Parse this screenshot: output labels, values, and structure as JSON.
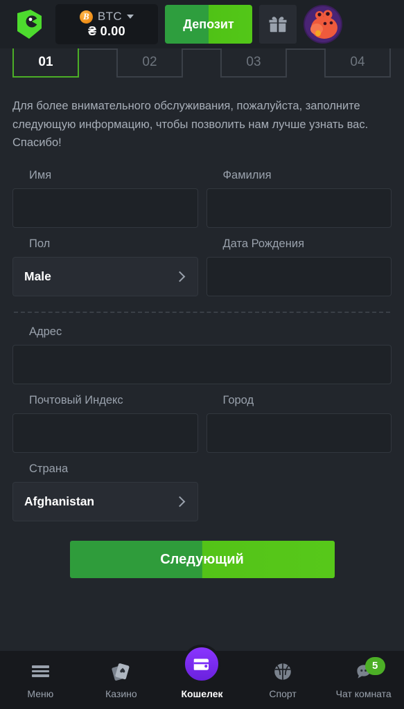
{
  "header": {
    "logo_icon": "bitkong-logo-icon",
    "currency": {
      "coin_icon": "bitcoin-coin-icon",
      "code": "BTC",
      "dropdown_icon": "chevron-down-icon",
      "balance": "₴ 0.00"
    },
    "deposit_label": "Депозит",
    "gift_icon": "gift-box-icon",
    "avatar_icon": "dragon-avatar-icon"
  },
  "steps": [
    {
      "label": "01",
      "active": true
    },
    {
      "label": "02",
      "active": false
    },
    {
      "label": "03",
      "active": false
    },
    {
      "label": "04",
      "active": false
    }
  ],
  "form": {
    "intro": "Для более внимательного обслуживания, пожалуйста, заполните следующую информацию, чтобы позволить нам лучше узнать вас. Спасибо!",
    "first_name": {
      "label": "Имя",
      "value": "",
      "placeholder": ""
    },
    "last_name": {
      "label": "Фамилия",
      "value": "",
      "placeholder": ""
    },
    "gender": {
      "label": "Пол",
      "value": "Male",
      "chevron_icon": "chevron-right-icon"
    },
    "birth_date": {
      "label": "Дата Рождения",
      "value": "",
      "placeholder": ""
    },
    "address": {
      "label": "Адрес",
      "value": "",
      "placeholder": ""
    },
    "postal_code": {
      "label": "Почтовый Индекс",
      "value": "",
      "placeholder": ""
    },
    "city": {
      "label": "Город",
      "value": "",
      "placeholder": ""
    },
    "country": {
      "label": "Страна",
      "value": "Afghanistan",
      "chevron_icon": "chevron-right-icon"
    },
    "next_label": "Следующий"
  },
  "bottom_nav": [
    {
      "label": "Меню",
      "icon": "hamburger-menu-icon",
      "active": false
    },
    {
      "label": "Казино",
      "icon": "playing-cards-icon",
      "active": false
    },
    {
      "label": "Кошелек",
      "icon": "wallet-icon",
      "active": true
    },
    {
      "label": "Спорт",
      "icon": "basketball-icon",
      "active": false
    },
    {
      "label": "Чат комната",
      "icon": "chat-bubble-icon",
      "active": false,
      "badge": "5"
    }
  ],
  "colors": {
    "page_bg": "#22262c",
    "header_bg": "#1d2126",
    "accent_green": "#4caf26",
    "deposit_green_dark": "#2e9e3e",
    "deposit_green_light": "#53c718",
    "wallet_purple": "#7b2ff7",
    "bitcoin_orange": "#f2931d"
  }
}
